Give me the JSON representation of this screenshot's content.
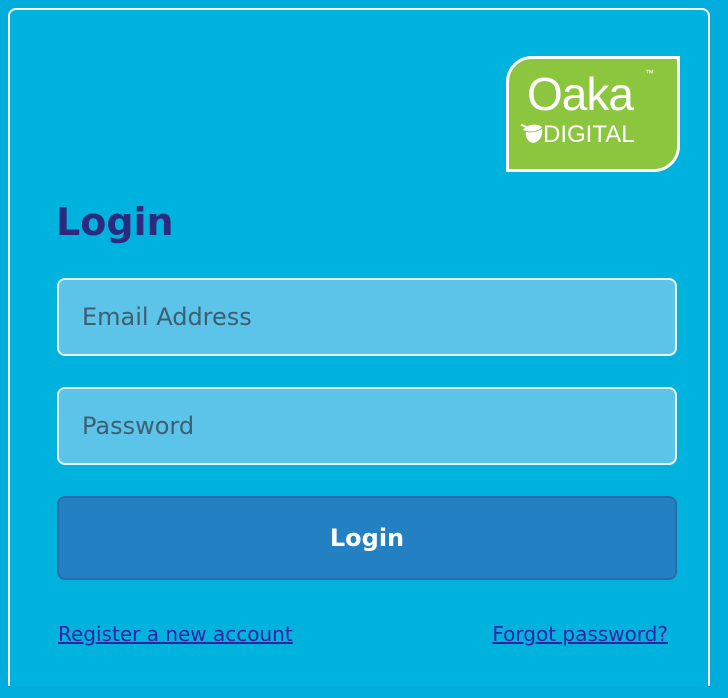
{
  "logo": {
    "word": "Oaka",
    "trademark": "™",
    "sub": "DIGITAL",
    "brand_color": "#8cc63f",
    "icon": "acorn-icon"
  },
  "form": {
    "title": "Login",
    "email_placeholder": "Email Address",
    "password_placeholder": "Password",
    "login_label": "Login",
    "register_link": "Register a new account",
    "forgot_link": "Forgot password?"
  },
  "colors": {
    "background": "#00b3de",
    "title": "#2b2a7e",
    "button": "#2380c2",
    "link": "#2c24a0"
  }
}
